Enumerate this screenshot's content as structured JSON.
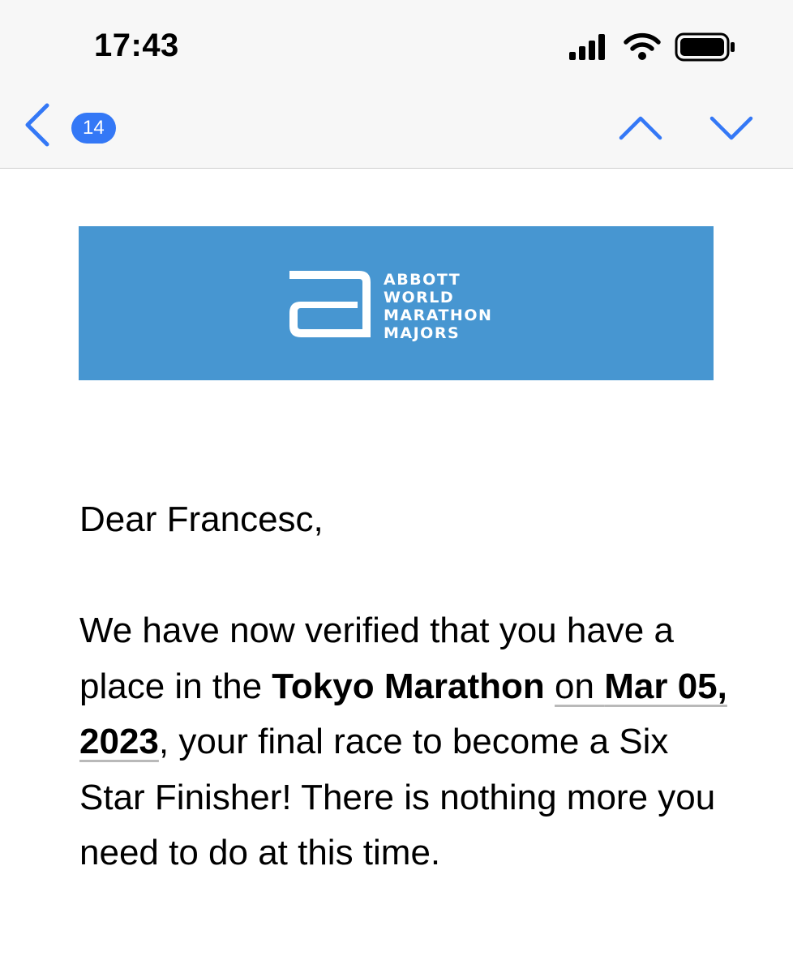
{
  "status_bar": {
    "time": "17:43",
    "icons": [
      "cellular-signal-icon",
      "wifi-icon",
      "battery-icon"
    ]
  },
  "nav_bar": {
    "back_icon": "chevron-left-icon",
    "unread_count": "14",
    "icons": [
      "chevron-up-icon",
      "chevron-down-icon"
    ],
    "accent_color": "#3478f6"
  },
  "banner": {
    "background_color": "#4796d1",
    "logo_lines": [
      "ABBOTT",
      "WORLD",
      "MARATHON",
      "MAJORS"
    ]
  },
  "email": {
    "greeting": "Dear Francesc,",
    "message": {
      "intro": "We have now verified that you have a place in the ",
      "race_name": "Tokyo Marathon",
      "on_word": "on ",
      "race_date": "Mar 05, 2023",
      "continuation": ", your final race to become a Six Star Finisher! There is nothing more you need to do at this time."
    }
  }
}
